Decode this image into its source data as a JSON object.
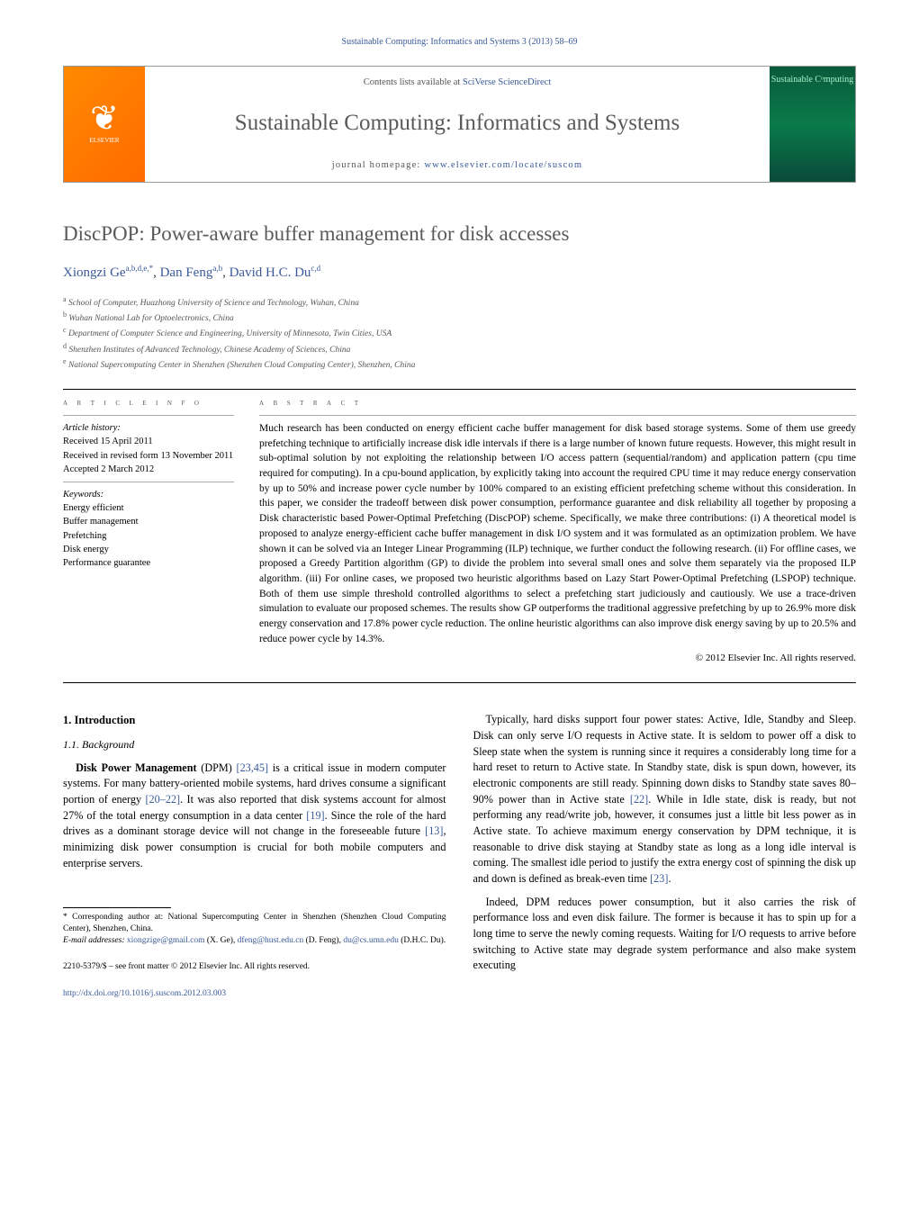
{
  "running_header": "Sustainable Computing: Informatics and Systems 3 (2013) 58–69",
  "header": {
    "contents_prefix": "Contents lists available at ",
    "contents_link": "SciVerse ScienceDirect",
    "journal_title": "Sustainable Computing: Informatics and Systems",
    "homepage_prefix": "journal homepage: ",
    "homepage_link": "www.elsevier.com/locate/suscom",
    "elsevier_label": "ELSEVIER",
    "cover_label": "Sustainable Cᵒmputing"
  },
  "title": "DiscPOP: Power-aware buffer management for disk accesses",
  "authors_html": "Xiongzi Ge",
  "authors": {
    "a1_name": "Xiongzi Ge",
    "a1_sup": "a,b,d,e,*",
    "a2_name": "Dan Feng",
    "a2_sup": "a,b",
    "a3_name": "David H.C. Du",
    "a3_sup": "c,d"
  },
  "affiliations": {
    "a": "School of Computer, Huazhong University of Science and Technology, Wuhan, China",
    "b": "Wuhan National Lab for Optoelectronics, China",
    "c": "Department of Computer Science and Engineering, University of Minnesota, Twin Cities, USA",
    "d": "Shenzhen Institutes of Advanced Technology, Chinese Academy of Sciences, China",
    "e": "National Supercomputing Center in Shenzhen (Shenzhen Cloud Computing Center), Shenzhen, China"
  },
  "article_info_label": "A R T I C L E  I N F O",
  "abstract_label": "A B S T R A C T",
  "history": {
    "heading": "Article history:",
    "received": "Received 15 April 2011",
    "revised": "Received in revised form 13 November 2011",
    "accepted": "Accepted 2 March 2012"
  },
  "keywords": {
    "heading": "Keywords:",
    "k1": "Energy efficient",
    "k2": "Buffer management",
    "k3": "Prefetching",
    "k4": "Disk energy",
    "k5": "Performance guarantee"
  },
  "abstract_text": "Much research has been conducted on energy efficient cache buffer management for disk based storage systems. Some of them use greedy prefetching technique to artificially increase disk idle intervals if there is a large number of known future requests. However, this might result in sub-optimal solution by not exploiting the relationship between I/O access pattern (sequential/random) and application pattern (cpu time required for computing). In a cpu-bound application, by explicitly taking into account the required CPU time it may reduce energy conservation by up to 50% and increase power cycle number by 100% compared to an existing efficient prefetching scheme without this consideration. In this paper, we consider the tradeoff between disk power consumption, performance guarantee and disk reliability all together by proposing a Disk characteristic based Power-Optimal Prefetching (DiscPOP) scheme. Specifically, we make three contributions: (i) A theoretical model is proposed to analyze energy-efficient cache buffer management in disk I/O system and it was formulated as an optimization problem. We have shown it can be solved via an Integer Linear Programming (ILP) technique, we further conduct the following research. (ii) For offline cases, we proposed a Greedy Partition algorithm (GP) to divide the problem into several small ones and solve them separately via the proposed ILP algorithm. (iii) For online cases, we proposed two heuristic algorithms based on Lazy Start Power-Optimal Prefetching (LSPOP) technique. Both of them use simple threshold controlled algorithms to select a prefetching start judiciously and cautiously. We use a trace-driven simulation to evaluate our proposed schemes. The results show GP outperforms the traditional aggressive prefetching by up to 26.9% more disk energy conservation and 17.8% power cycle reduction. The online heuristic algorithms can also improve disk energy saving by up to 20.5% and reduce power cycle by 14.3%.",
  "copyright": "© 2012 Elsevier Inc. All rights reserved.",
  "section1": {
    "num_title": "1. Introduction",
    "sub_title": "1.1. Background",
    "p1_lead": "Disk Power Management",
    "p1_rest": " (DPM) ",
    "p1_ref1": "[23,45]",
    "p1_mid": " is a critical issue in modern computer systems. For many battery-oriented mobile systems, hard drives consume a significant portion of energy ",
    "p1_ref2": "[20–22]",
    "p1_mid2": ". It was also reported that disk systems account for almost 27% of the total energy consumption in a data center ",
    "p1_ref3": "[19]",
    "p1_mid3": ". Since the role of the hard drives as a dominant storage device will not change in the foreseeable future ",
    "p1_ref4": "[13]",
    "p1_end": ", minimizing disk power consumption is crucial for both mobile computers and enterprise servers."
  },
  "col2": {
    "p1a": "Typically, hard disks support four power states: Active, Idle, Standby and Sleep. Disk can only serve I/O requests in Active state. It is seldom to power off a disk to Sleep state when the system is running since it requires a considerably long time for a hard reset to return to Active state. In Standby state, disk is spun down, however, its electronic components are still ready. Spinning down disks to Standby state saves 80–90% power than in Active state ",
    "p1_ref1": "[22]",
    "p1b": ". While in Idle state, disk is ready, but not performing any read/write job, however, it consumes just a little bit less power as in Active state. To achieve maximum energy conservation by DPM technique, it is reasonable to drive disk staying at Standby state as long as a long idle interval is coming. The smallest idle period to justify the extra energy cost of spinning the disk up and down is defined as break-even time ",
    "p1_ref2": "[23]",
    "p1c": ".",
    "p2": "Indeed, DPM reduces power consumption, but it also carries the risk of performance loss and even disk failure. The former is because it has to spin up for a long time to serve the newly coming requests. Waiting for I/O requests to arrive before switching to Active state may degrade system performance and also make system executing"
  },
  "footnotes": {
    "corr_label": "* Corresponding author at: National Supercomputing Center in Shenzhen (Shenzhen Cloud Computing Center), Shenzhen, China.",
    "email_label": "E-mail addresses: ",
    "email1": "xiongzige@gmail.com",
    "email1_who": " (X. Ge), ",
    "email2": "dfeng@hust.edu.cn",
    "email2_who": " (D. Feng), ",
    "email3": "du@cs.umn.edu",
    "email3_who": " (D.H.C. Du)."
  },
  "bottom": {
    "line1": "2210-5379/$ – see front matter © 2012 Elsevier Inc. All rights reserved.",
    "doi": "http://dx.doi.org/10.1016/j.suscom.2012.03.003"
  }
}
